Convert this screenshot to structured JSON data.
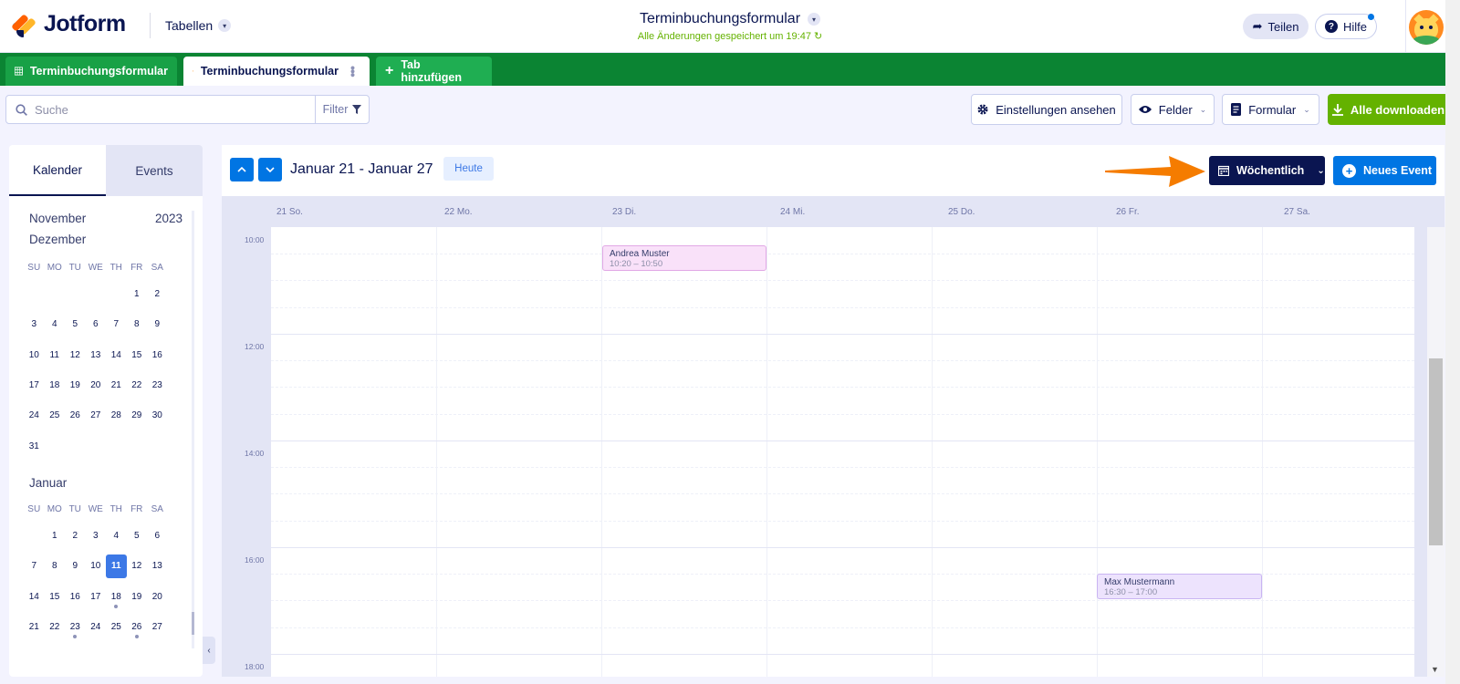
{
  "header": {
    "brand": "Jotform",
    "tables_label": "Tabellen",
    "form_title": "Terminbuchungsformular",
    "saved_status": "Alle Änderungen gespeichert um 19:47 ↻",
    "share_label": "Teilen",
    "help_label": "Hilfe"
  },
  "tabs": [
    {
      "label": "Terminbuchungsformular",
      "icon": "table-grid-icon"
    },
    {
      "label": "Terminbuchungsformular",
      "icon": "calendar-icon",
      "active": true
    },
    {
      "label": "Tab hinzufügen",
      "icon": "plus-icon"
    }
  ],
  "toolbar": {
    "search_placeholder": "Suche",
    "filter_label": "Filter",
    "settings_label": "Einstellungen ansehen",
    "fields_label": "Felder",
    "form_label": "Formular",
    "download_label": "Alle downloaden"
  },
  "sidebar": {
    "tab_calendar": "Kalender",
    "tab_events": "Events",
    "year": "2023",
    "weekdays": [
      "SU",
      "MO",
      "TU",
      "WE",
      "TH",
      "FR",
      "SA"
    ],
    "months": [
      {
        "name": "November"
      },
      {
        "name": "Dezember",
        "days": [
          "",
          "",
          "",
          "",
          "",
          "1",
          "2",
          "3",
          "4",
          "5",
          "6",
          "7",
          "8",
          "9",
          "10",
          "11",
          "12",
          "13",
          "14",
          "15",
          "16",
          "17",
          "18",
          "19",
          "20",
          "21",
          "22",
          "23",
          "24",
          "25",
          "26",
          "27",
          "28",
          "29",
          "30",
          "31"
        ]
      },
      {
        "name": "Januar",
        "days": [
          "",
          "1",
          "2",
          "3",
          "4",
          "5",
          "6",
          "7",
          "8",
          "9",
          "10",
          "11",
          "12",
          "13",
          "14",
          "15",
          "16",
          "17",
          "18",
          "19",
          "20",
          "21",
          "22",
          "23",
          "24",
          "25",
          "26",
          "27"
        ],
        "selected": "11",
        "dots": [
          "18",
          "23",
          "26"
        ]
      }
    ]
  },
  "calendar": {
    "range_label": "Januar 21 - Januar 27",
    "today_label": "Heute",
    "view_label": "Wöchentlich",
    "new_event_label": "Neues Event",
    "days": [
      "21 So.",
      "22 Mo.",
      "23 Di.",
      "24 Mi.",
      "25 Do.",
      "26 Fr.",
      "27 Sa."
    ],
    "time_labels": [
      "10:00",
      "12:00",
      "14:00",
      "16:00",
      "18:00"
    ],
    "events": [
      {
        "name": "Andrea Muster",
        "time": "10:20 – 10:50",
        "day": "23 Di."
      },
      {
        "name": "Max Mustermann",
        "time": "16:30 – 17:00",
        "day": "26 Fr."
      }
    ]
  },
  "colors": {
    "brand_navy": "#0a1551",
    "tab_bar_green": "#0b8433",
    "download_green": "#64b200",
    "primary_blue": "#0075e3",
    "annotation_arrow": "#f57c00"
  }
}
